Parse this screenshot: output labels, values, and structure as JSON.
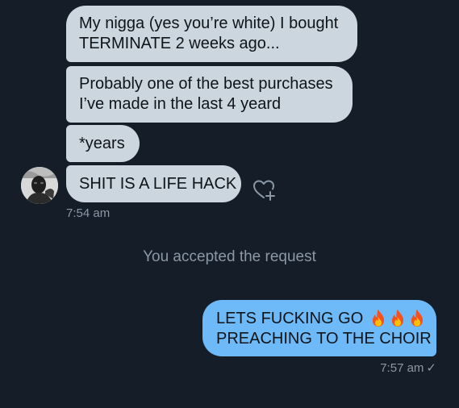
{
  "thread": {
    "incoming": [
      {
        "lines": [
          "My nigga (yes you’re white) I bought",
          "TERMINATE 2 weeks ago..."
        ]
      },
      {
        "lines": [
          "Probably one of the best purchases",
          "I’ve made in the last 4 yeard"
        ]
      },
      {
        "lines": [
          "*years"
        ]
      },
      {
        "lines": [
          "SHIT IS A LIFE HACK"
        ]
      }
    ],
    "incoming_time": "7:54 am",
    "system_message": "You accepted the request",
    "outgoing": {
      "line1": "LETS FUCKING GO",
      "line2": "PREACHING TO THE CHOIR",
      "emoji_count": 3
    },
    "outgoing_time": "7:57 am",
    "read_receipt": "✓"
  },
  "icons": {
    "avatar": "user-avatar-photo",
    "react": "heart-plus-icon",
    "emoji": "fire-emoji"
  },
  "colors": {
    "background": "#141d28",
    "incoming_bubble": "#cbd6df",
    "outgoing_bubble": "#6ebaf8",
    "meta_text": "#8b98a5"
  }
}
